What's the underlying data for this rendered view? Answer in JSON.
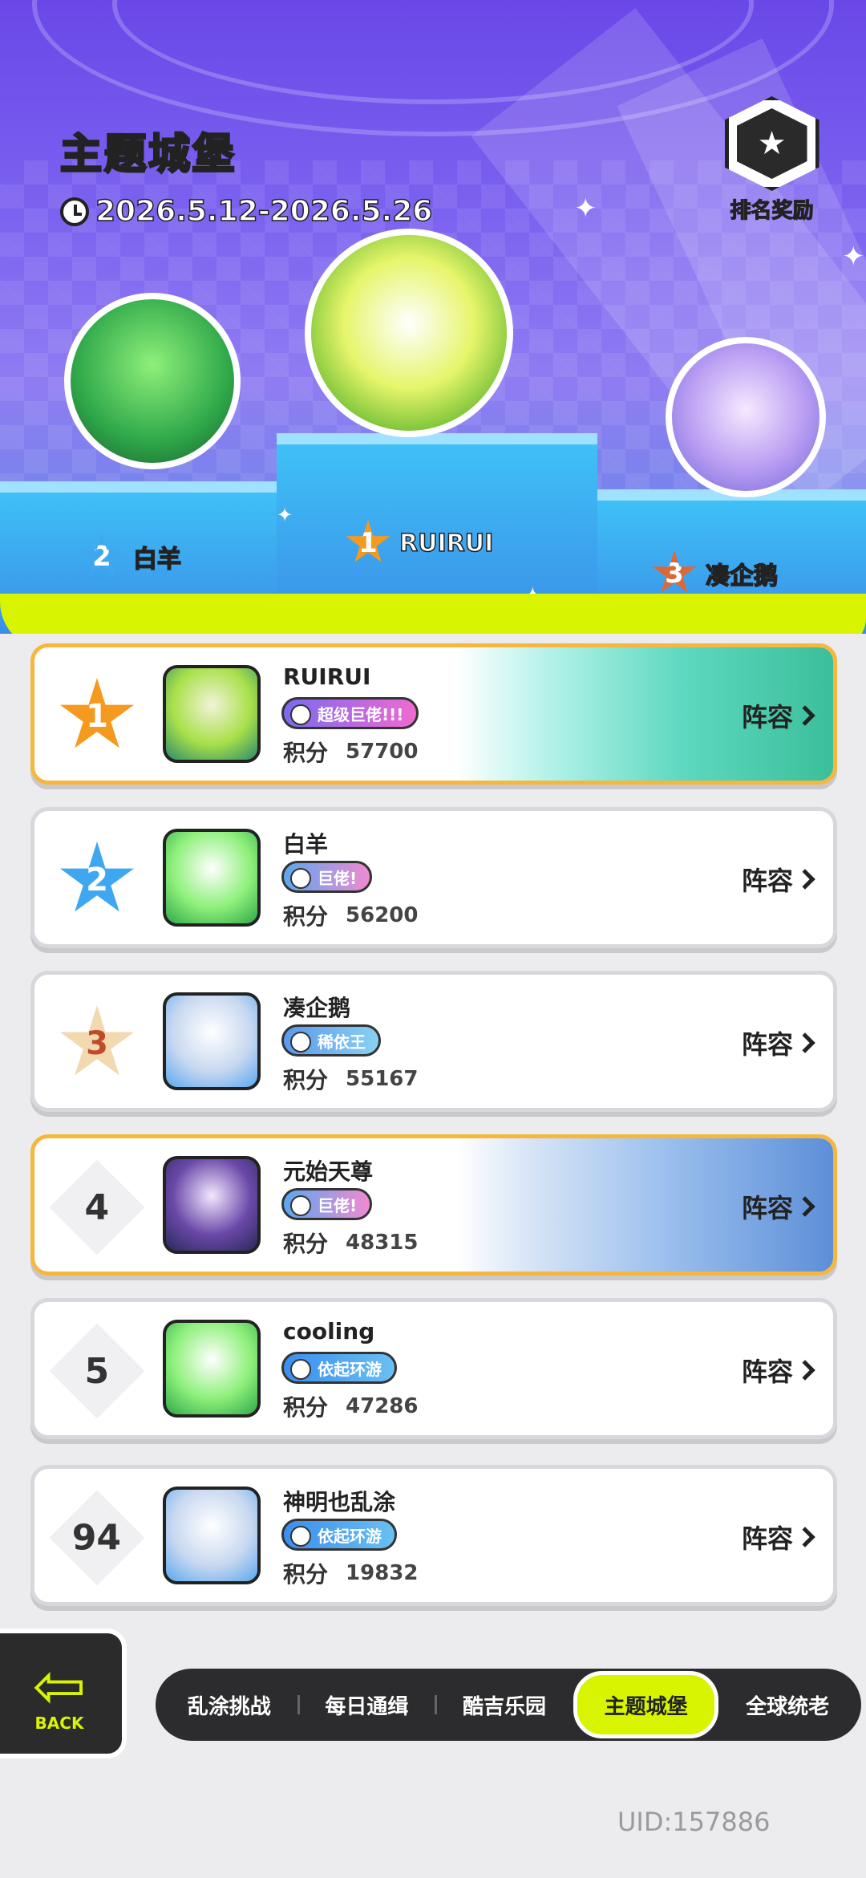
{
  "header": {
    "title": "主题城堡",
    "date_range": "2026.5.12-2026.5.26",
    "reward_label": "排名奖励"
  },
  "podium": [
    {
      "rank": "2",
      "name": "白羊"
    },
    {
      "rank": "1",
      "name": "RUIRUI"
    },
    {
      "rank": "3",
      "name": "凑企鹅"
    }
  ],
  "leaderboard": [
    {
      "rank": "1",
      "name": "RUIRUI",
      "title": "超级巨佬!!!",
      "score_label": "积分",
      "score": "57700",
      "team_label": "阵容"
    },
    {
      "rank": "2",
      "name": "白羊",
      "title": "巨佬!",
      "score_label": "积分",
      "score": "56200",
      "team_label": "阵容"
    },
    {
      "rank": "3",
      "name": "凑企鹅",
      "title": "稀依王",
      "score_label": "积分",
      "score": "55167",
      "team_label": "阵容"
    },
    {
      "rank": "4",
      "name": "元始天尊",
      "title": "巨佬!",
      "score_label": "积分",
      "score": "48315",
      "team_label": "阵容"
    },
    {
      "rank": "5",
      "name": "cooling",
      "title": "依起环游",
      "score_label": "积分",
      "score": "47286",
      "team_label": "阵容"
    },
    {
      "rank": "94",
      "name": "神明也乱涂",
      "title": "依起环游",
      "score_label": "积分",
      "score": "19832",
      "team_label": "阵容"
    }
  ],
  "back_label": "BACK",
  "nav": [
    "乱涂挑战",
    "每日通缉",
    "酷吉乐园",
    "主题城堡",
    "全球统老"
  ],
  "nav_active": "主题城堡",
  "uid": "UID:157886",
  "colors": {
    "accent": "#d8f400",
    "gold": "#f6b73c",
    "header_purple": "#6a48e8",
    "stage_blue": "#3fc0f6"
  }
}
